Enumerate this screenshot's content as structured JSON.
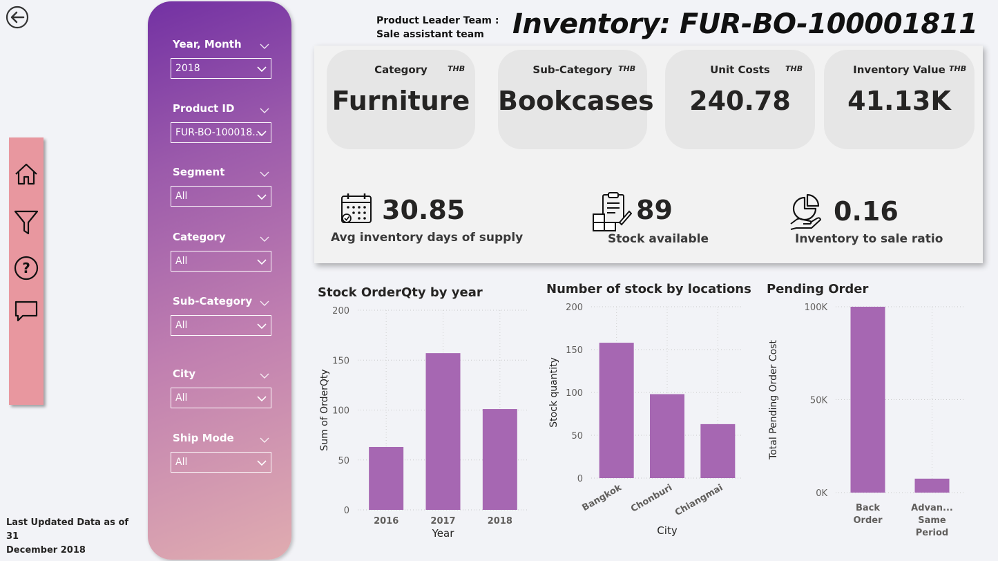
{
  "header": {
    "team_line1": "Product Leader Team :",
    "team_line2": "Sale assistant team",
    "title": "Inventory: FUR-BO-100001811"
  },
  "footer": {
    "updated_line1": "Last Updated Data as of 31",
    "updated_line2": "December 2018"
  },
  "nav": {
    "icons": [
      "home-icon",
      "filter-icon",
      "help-icon",
      "comment-icon"
    ]
  },
  "filters": [
    {
      "label": "Year, Month",
      "value": "2018"
    },
    {
      "label": "Product ID",
      "value": "FUR-BO-100018..."
    },
    {
      "label": "Segment",
      "value": "All"
    },
    {
      "label": "Category",
      "value": "All"
    },
    {
      "label": "Sub-Category",
      "value": "All"
    },
    {
      "label": "City",
      "value": "All"
    },
    {
      "label": "Ship Mode",
      "value": "All"
    }
  ],
  "cards": [
    {
      "title": "Category",
      "unit": "THB",
      "value": "Furniture"
    },
    {
      "title": "Sub-Category",
      "unit": "THB",
      "value": "Bookcases"
    },
    {
      "title": "Unit Costs",
      "unit": "THB",
      "value": "240.78"
    },
    {
      "title": "Inventory Value",
      "unit": "THB",
      "value": "41.13K"
    }
  ],
  "metrics": [
    {
      "value": "30.85",
      "label": "Avg inventory days of supply",
      "icon": "calendar-icon"
    },
    {
      "value": "89",
      "label": "Stock available",
      "icon": "stock-clipboard-icon"
    },
    {
      "value": "0.16",
      "label": "Inventory to sale ratio",
      "icon": "pie-hand-icon"
    }
  ],
  "colors": {
    "bar": "#a667b2",
    "panel": "#f2f2f2",
    "card": "#e6e6e6"
  },
  "chart_data": [
    {
      "type": "bar",
      "title": "Stock OrderQty by year",
      "xlabel": "Year",
      "ylabel": "Sum of OrderQty",
      "categories": [
        "2016",
        "2017",
        "2018"
      ],
      "values": [
        63,
        157,
        101
      ],
      "ylim": [
        0,
        200
      ],
      "yticks": [
        "0",
        "50",
        "100",
        "150",
        "200"
      ],
      "grid": true
    },
    {
      "type": "bar",
      "title": "Number of stock by locations",
      "xlabel": "City",
      "ylabel": "Stock quantity",
      "categories": [
        "Bangkok",
        "Chonburi",
        "Chiangmai"
      ],
      "values": [
        158,
        98,
        63
      ],
      "ylim": [
        0,
        200
      ],
      "yticks": [
        "0",
        "50",
        "100",
        "150",
        "200"
      ],
      "grid": true
    },
    {
      "type": "bar",
      "title": "Pending Order",
      "xlabel": "",
      "ylabel": "Total Pending Order Cost",
      "categories": [
        "Back Order",
        "Advan... Same Period"
      ],
      "values": [
        100000,
        7500
      ],
      "ylim": [
        0,
        100000
      ],
      "yticks": [
        "0K",
        "50K",
        "100K"
      ],
      "grid": true
    }
  ]
}
